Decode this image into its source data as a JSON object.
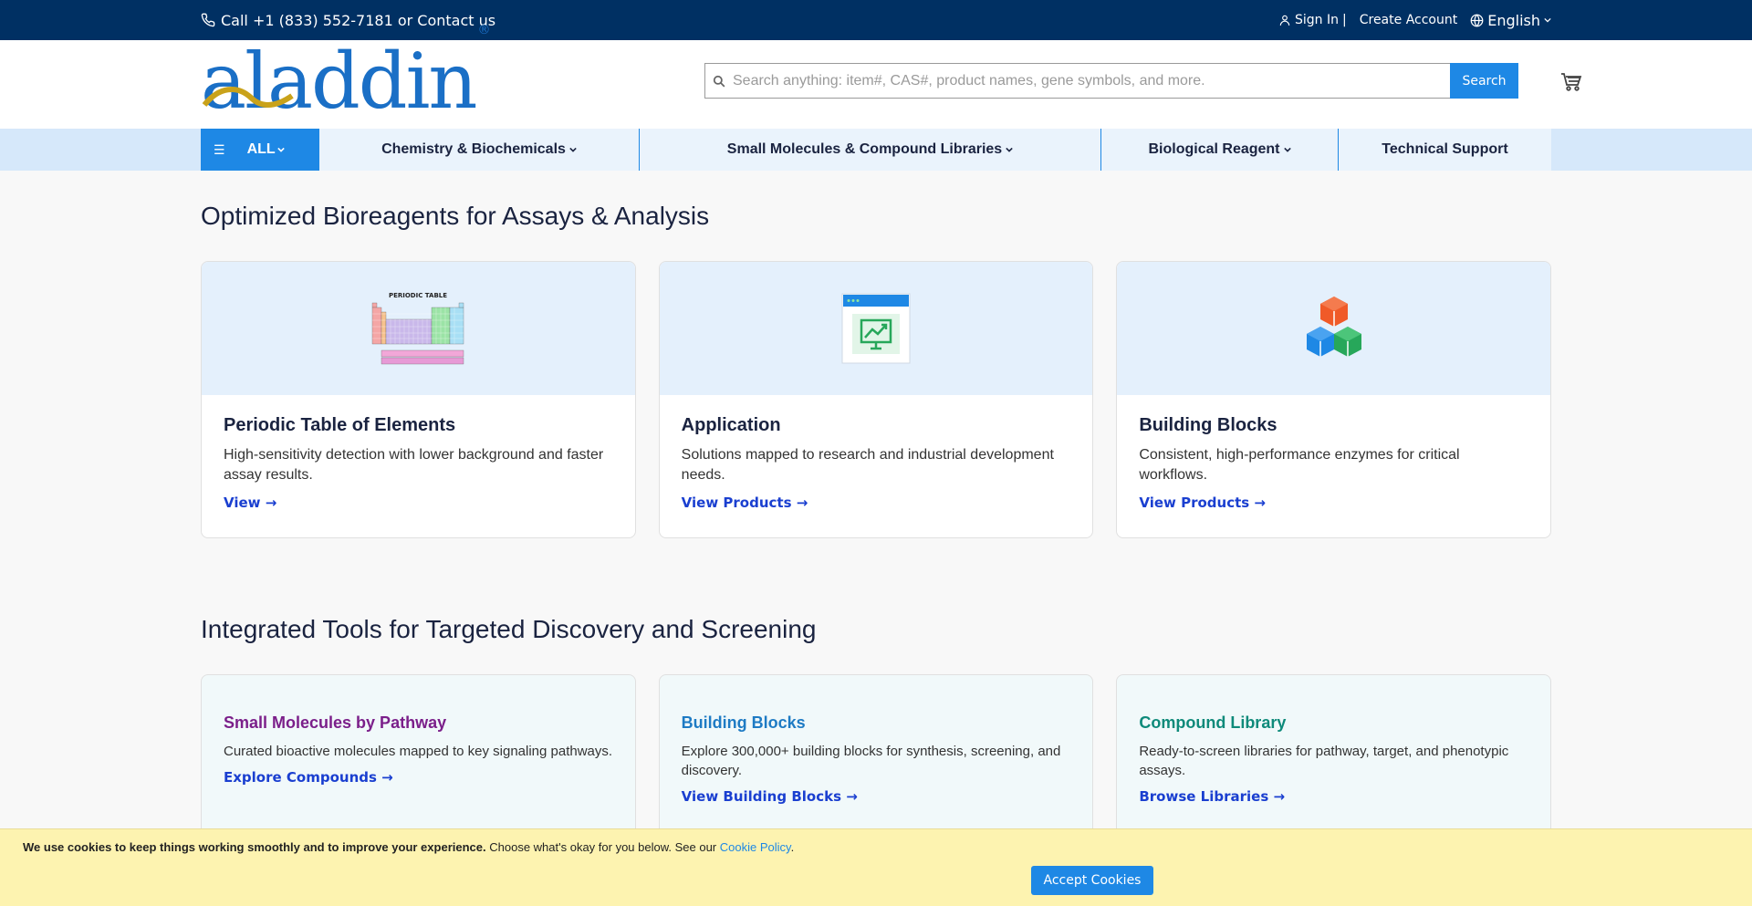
{
  "topbar": {
    "phone_text": "Call +1 (833) 552-7181 or Contact us",
    "sign_in": "Sign In",
    "separator": "|",
    "create_account": "Create Account",
    "language": "English"
  },
  "header": {
    "logo_text": "aladdin",
    "logo_mark": "®",
    "search_placeholder": "Search anything: item#, CAS#, product names, gene symbols, and more.",
    "search_button": "Search"
  },
  "nav": {
    "all_label": "ALL",
    "items": [
      {
        "label": "Chemistry & Biochemicals",
        "has_dropdown": true
      },
      {
        "label": "Small Molecules & Compound Libraries",
        "has_dropdown": true
      },
      {
        "label": "Biological Reagent",
        "has_dropdown": true
      },
      {
        "label": "Technical Support",
        "has_dropdown": false
      }
    ]
  },
  "section1": {
    "title": "Optimized Bioreagents for Assays & Analysis",
    "cards": [
      {
        "image_label": "PERIODIC TABLE",
        "title": "Periodic Table of Elements",
        "desc": "High-sensitivity detection with lower background and faster assay results.",
        "link": "View →",
        "icon": "periodic-table-icon"
      },
      {
        "title": "Application",
        "desc": "Solutions mapped to research and industrial development needs.",
        "link": "View Products →",
        "icon": "chart-monitor-icon"
      },
      {
        "title": "Building Blocks",
        "desc": "Consistent, high-performance enzymes for critical workflows.",
        "link": "View Products →",
        "icon": "cubes-icon"
      }
    ]
  },
  "section2": {
    "title": "Integrated Tools for Targeted Discovery and Screening",
    "cards": [
      {
        "title": "Small Molecules by Pathway",
        "desc": "Curated bioactive molecules mapped to key signaling pathways.",
        "link": "Explore Compounds →",
        "color": "#7b1f8a"
      },
      {
        "title": "Building Blocks",
        "desc": "Explore 300,000+ building blocks for synthesis, screening, and discovery.",
        "link": "View Building Blocks →",
        "color": "#1e7bc4"
      },
      {
        "title": "Compound Library",
        "desc": "Ready-to-screen libraries for pathway, target, and phenotypic assays.",
        "link": "Browse Libraries →",
        "color": "#0e8a7a"
      }
    ]
  },
  "cookie": {
    "bold": "We use cookies to keep things working smoothly and to improve your experience.",
    "text": "Choose what's okay for you below. See our",
    "link": "Cookie Policy",
    "period": ".",
    "accept": "Accept Cookies"
  }
}
